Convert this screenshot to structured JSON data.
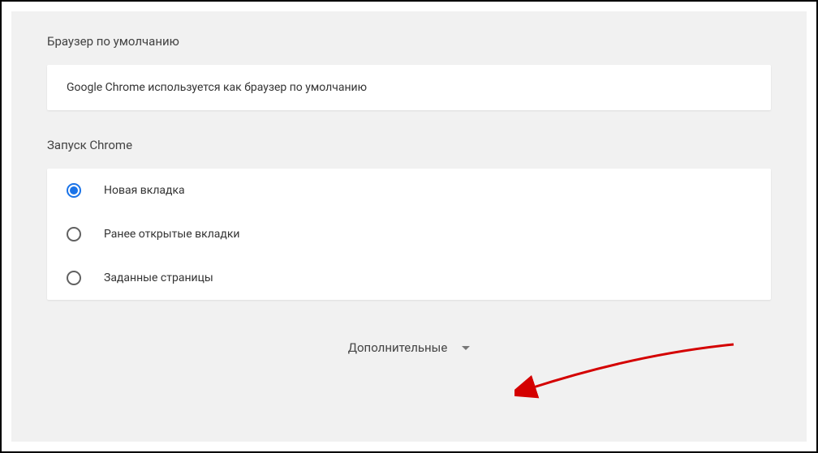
{
  "sections": {
    "defaultBrowser": {
      "heading": "Браузер по умолчанию",
      "statusText": "Google Chrome используется как браузер по умолчанию"
    },
    "onStartup": {
      "heading": "Запуск Chrome",
      "options": [
        {
          "label": "Новая вкладка",
          "selected": true
        },
        {
          "label": "Ранее открытые вкладки",
          "selected": false
        },
        {
          "label": "Заданные страницы",
          "selected": false
        }
      ]
    }
  },
  "advanced": {
    "label": "Дополнительные"
  }
}
